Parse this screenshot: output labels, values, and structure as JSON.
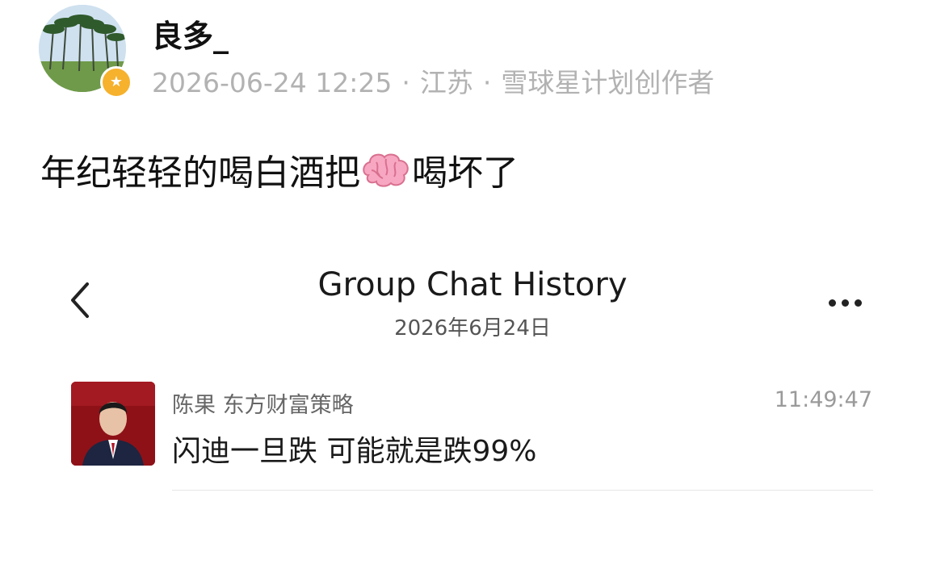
{
  "post": {
    "username": "良多_",
    "timestamp": "2026-06-24 12:25",
    "location": "江苏",
    "creator_badge": "雪球星计划创作者",
    "separator": "·",
    "text_before_emoji": "年纪轻轻的喝白酒把",
    "emoji": "brain-emoji",
    "text_after_emoji": "喝坏了"
  },
  "chat_history": {
    "title": "Group Chat History",
    "date": "2026年6月24日",
    "message": {
      "sender": "陈果 东方财富策略",
      "time": "11:49:47",
      "text": "闪迪一旦跌 可能就是跌99%"
    }
  },
  "colors": {
    "meta_gray": "#b2b2b2",
    "badge_gold": "#f6b12d",
    "avatar_red": "#8e1118"
  }
}
